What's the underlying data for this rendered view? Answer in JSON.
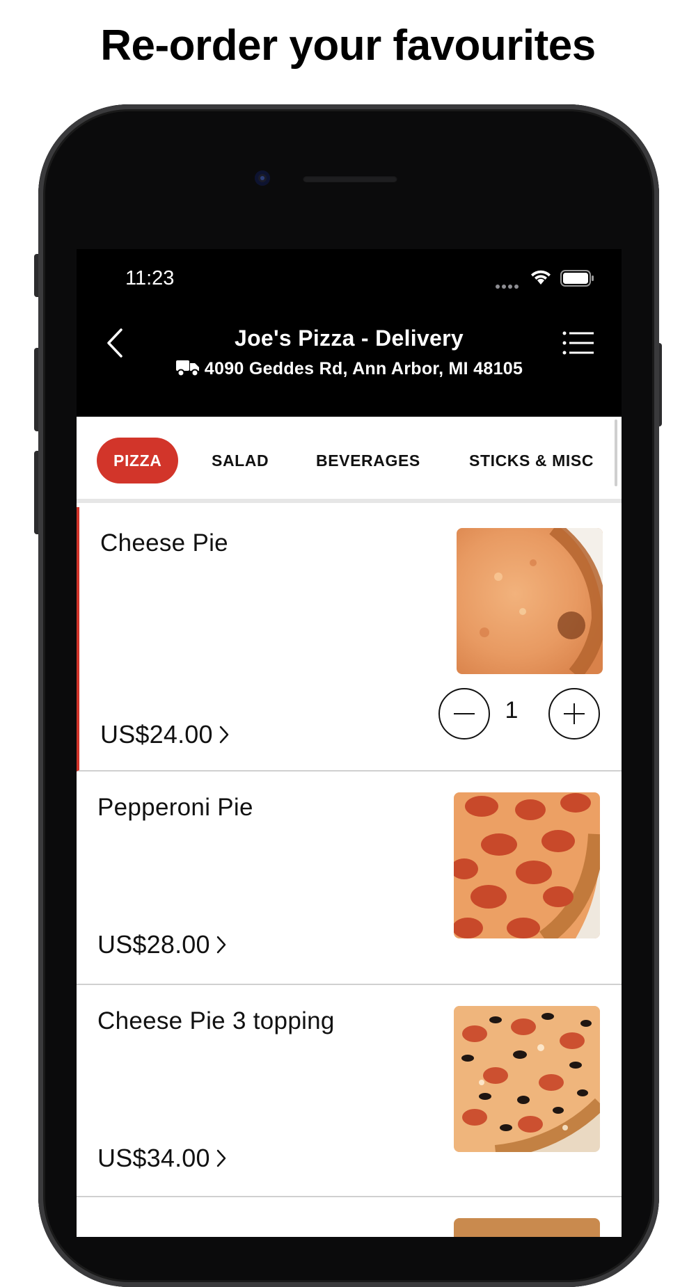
{
  "headline": "Re-order your favourites",
  "status_bar": {
    "time": "11:23"
  },
  "header": {
    "title": "Joe's Pizza - Delivery",
    "address": "4090 Geddes Rd, Ann Arbor, MI 48105"
  },
  "tabs": [
    {
      "label": "PIZZA",
      "active": true
    },
    {
      "label": "SALAD",
      "active": false
    },
    {
      "label": "BEVERAGES",
      "active": false
    },
    {
      "label": "STICKS & MISC",
      "active": false
    }
  ],
  "menu_items": [
    {
      "name": "Cheese Pie",
      "price": "US$24.00",
      "quantity": "1",
      "image": "cheese-pizza"
    },
    {
      "name": "Pepperoni Pie",
      "price": "US$28.00",
      "image": "pepperoni-pizza"
    },
    {
      "name": "Cheese Pie 3 topping",
      "price": "US$34.00",
      "image": "topping-pizza"
    }
  ],
  "colors": {
    "accent": "#d2352a",
    "header_bg": "#000000"
  }
}
